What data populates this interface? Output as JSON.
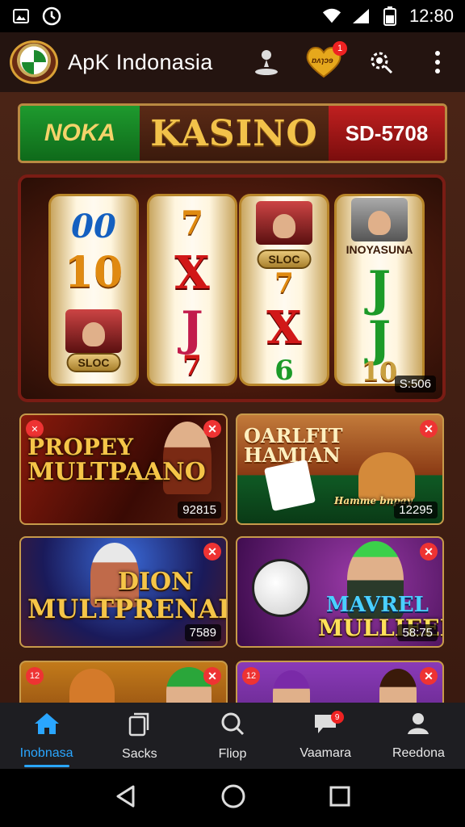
{
  "status_bar": {
    "time": "12:80",
    "icons": [
      "gallery-icon",
      "clock-icon",
      "wifi-icon",
      "signal-icon",
      "battery-icon"
    ]
  },
  "app_bar": {
    "title": "ApK Indonasia",
    "notification_count": "1",
    "heart_text": "ɒʌɿɔɘ",
    "icons": [
      "person-icon",
      "heart-icon",
      "settings-gear-icon",
      "more-vert-icon"
    ]
  },
  "banner": {
    "left": "NOKA",
    "center": "KASINO",
    "right": "SD-5708"
  },
  "slot": {
    "reel1": [
      "00",
      "10",
      "SLOC"
    ],
    "reel2": [
      "7",
      "X",
      "J",
      "7"
    ],
    "reel3": [
      "SLOC",
      "7",
      "X",
      "6"
    ],
    "reel4": [
      "INOYASUNA",
      "J",
      "J",
      "10"
    ],
    "counter": "S:506"
  },
  "cards": [
    {
      "title_line1": "PROPEY",
      "title_line2": "MULTPAANO",
      "count": "92815"
    },
    {
      "title_line1": "OARLFIT HAMIAN",
      "title_line2": "",
      "count": "12295",
      "sub": "Hamme bnpay"
    },
    {
      "title_line1": "DION",
      "title_line2": "MULTPRENAR",
      "count": "7589"
    },
    {
      "title_line1": "MAVREL",
      "title_line2": "MULLIEEL",
      "count": "58:75"
    },
    {
      "title_line1": "",
      "title_line2": "",
      "count": ""
    },
    {
      "title_line1": "",
      "title_line2": "",
      "count": ""
    }
  ],
  "badges": {
    "card1_left": "✕",
    "card5_left": "12",
    "card6_left": "12"
  },
  "bottom_nav": [
    {
      "label": "Inobnasa",
      "icon": "home-icon",
      "active": true
    },
    {
      "label": "Sacks",
      "icon": "stack-icon"
    },
    {
      "label": "Fliop",
      "icon": "search-icon"
    },
    {
      "label": "Vaamara",
      "icon": "chat-icon",
      "badge": "9"
    },
    {
      "label": "Reedona",
      "icon": "profile-icon"
    }
  ],
  "colors": {
    "accent_blue": "#2aa6ff",
    "brand_gold": "#f2c24a",
    "badge_red": "#e33333"
  }
}
